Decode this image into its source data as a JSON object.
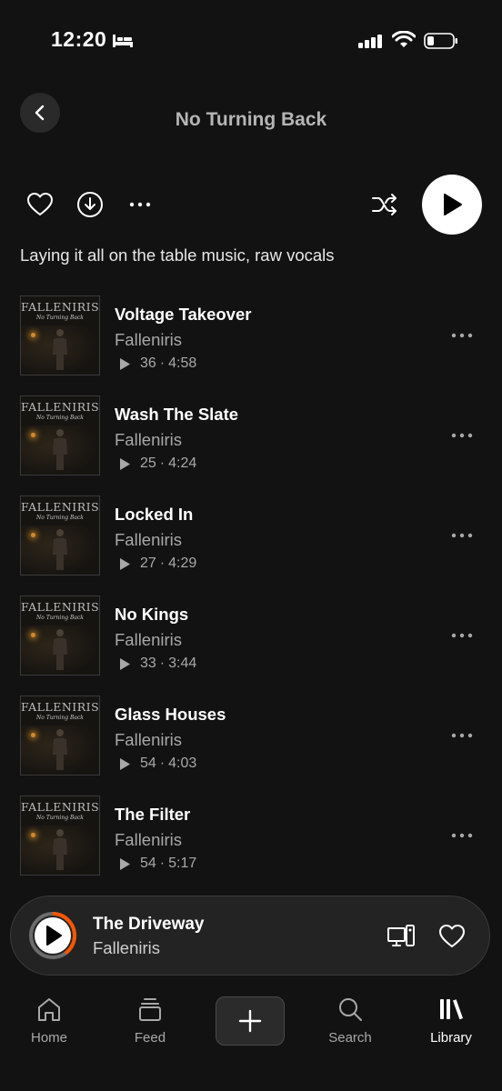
{
  "status_bar": {
    "time": "12:20"
  },
  "header": {
    "title": "No Turning Back"
  },
  "playlist": {
    "description": "Laying it all on the table music, raw vocals"
  },
  "art": {
    "band": "FALLENIRIS",
    "subtitle": "No Turning Back"
  },
  "tracks": [
    {
      "title": "Voltage Takeover",
      "artist": "Falleniris",
      "plays": "36",
      "duration": "4:58"
    },
    {
      "title": "Wash The Slate",
      "artist": "Falleniris",
      "plays": "25",
      "duration": "4:24"
    },
    {
      "title": "Locked In",
      "artist": "Falleniris",
      "plays": "27",
      "duration": "4:29"
    },
    {
      "title": "No Kings",
      "artist": "Falleniris",
      "plays": "33",
      "duration": "3:44"
    },
    {
      "title": "Glass Houses",
      "artist": "Falleniris",
      "plays": "54",
      "duration": "4:03"
    },
    {
      "title": "The Filter",
      "artist": "Falleniris",
      "plays": "54",
      "duration": "5:17"
    }
  ],
  "now_playing": {
    "title": "The Driveway",
    "artist": "Falleniris",
    "progress": 0.4
  },
  "nav": {
    "home": "Home",
    "feed": "Feed",
    "search": "Search",
    "library": "Library"
  },
  "colors": {
    "accent": "#ff5500",
    "background": "#121212"
  },
  "icons": [
    "back-icon",
    "heart-icon",
    "download-icon",
    "more-icon",
    "shuffle-icon",
    "play-icon",
    "device-icon",
    "home-icon",
    "feed-icon",
    "plus-icon",
    "search-icon",
    "library-icon"
  ]
}
